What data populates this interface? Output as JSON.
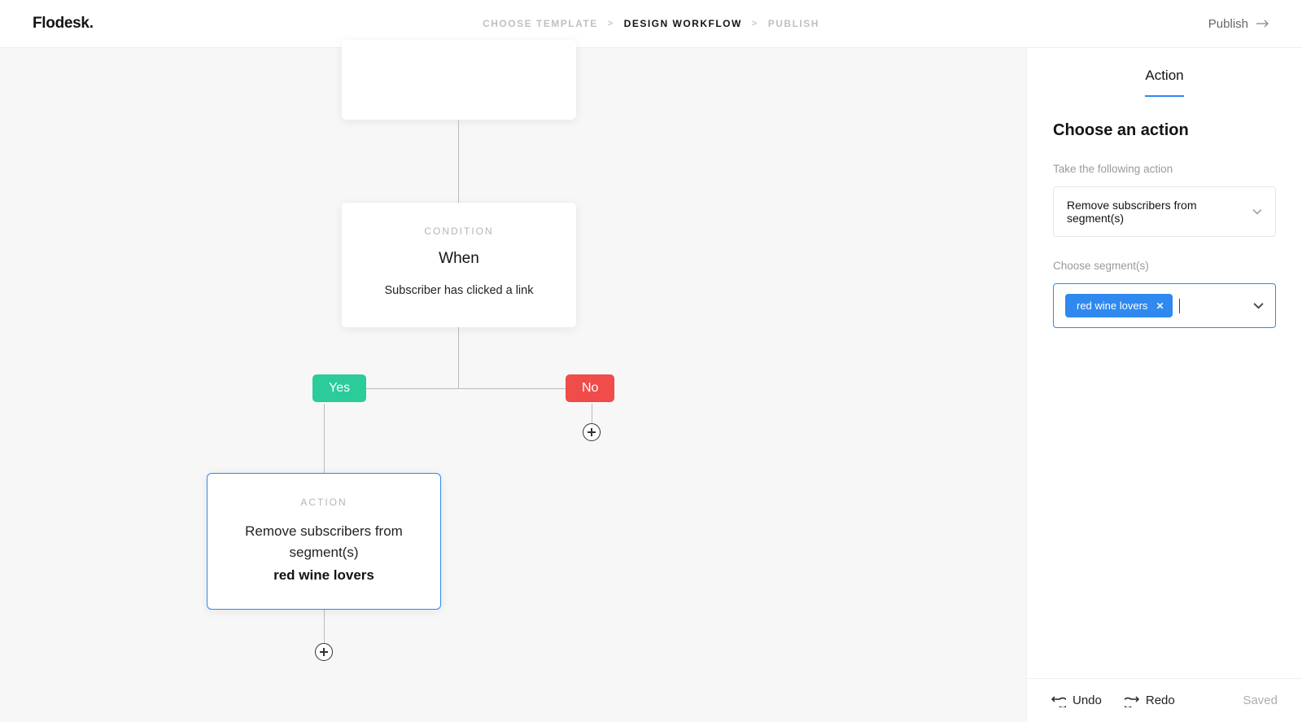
{
  "logo": "Flodesk.",
  "breadcrumb": {
    "step1": "Choose Template",
    "step2": "Design Workflow",
    "step3": "Publish"
  },
  "publish_label": "Publish",
  "workflow": {
    "condition": {
      "label": "Condition",
      "title": "When",
      "desc": "Subscriber has clicked a link"
    },
    "branch_yes": "Yes",
    "branch_no": "No",
    "action": {
      "label": "Action",
      "desc": "Remove subscribers from segment(s)",
      "segment": "red wine lovers"
    }
  },
  "sidebar": {
    "tab": "Action",
    "heading": "Choose an action",
    "action_label": "Take the following action",
    "action_value": "Remove subscribers from segment(s)",
    "segments_label": "Choose segment(s)",
    "tags": [
      "red wine lovers"
    ],
    "footer": {
      "undo": "Undo",
      "redo": "Redo",
      "saved": "Saved"
    }
  }
}
